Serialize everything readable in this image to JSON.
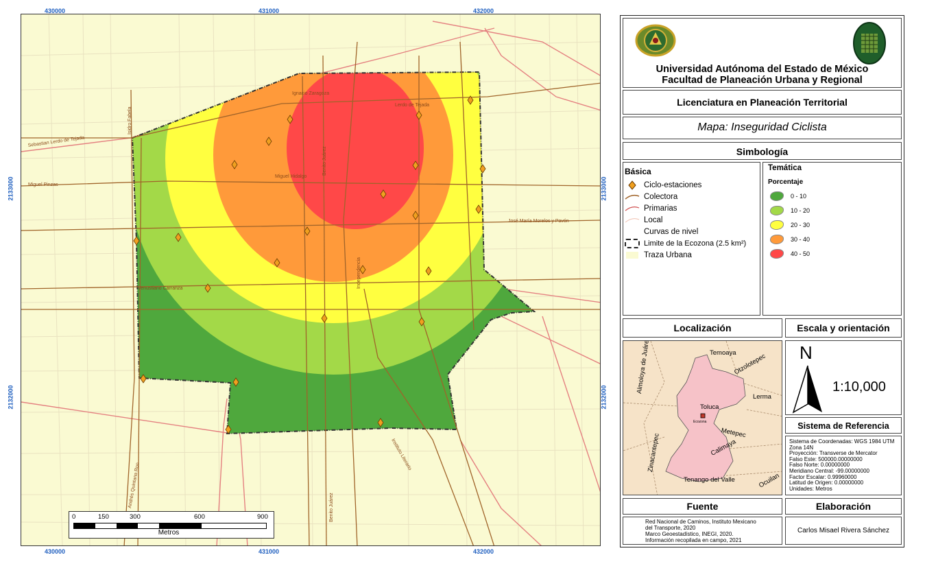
{
  "map": {
    "coords_top": [
      "430000",
      "431000",
      "432000"
    ],
    "coords_bottom": [
      "430000",
      "431000",
      "432000"
    ],
    "coords_left": [
      "2133000",
      "2132000"
    ],
    "coords_right": [
      "2133000",
      "2132000"
    ],
    "streets": {
      "s1": "Sebastian Lerdo de Tejada",
      "s2": "Miguel Pinzas",
      "s3": "Miguel Hidalgo",
      "s4": "José María Morelos y Pavón",
      "s5": "Venustiano Carranza",
      "s6": "Ignacio Zaragoza",
      "s7": "Lerdo de Tejada",
      "s8": "Benito Juárez",
      "s9": "Independencia",
      "s10": "Isidro Fabela",
      "s11": "Andrés Quintana Roo",
      "s12": "Benito Juárez",
      "s13": "Instituto Literario"
    }
  },
  "scale_bar": {
    "ticks": [
      "0",
      "150",
      "300",
      "600",
      "900"
    ],
    "unit": "Metros"
  },
  "header": {
    "university": "Universidad Autónoma del Estado de México",
    "faculty": "Facultad de Planeación Urbana y Regional",
    "degree": "Licenciatura en Planeación Territorial",
    "map_title": "Mapa: Inseguridad Ciclista"
  },
  "legend": {
    "title": "Simbología",
    "basic_title": "Básica",
    "basic_items": [
      "Ciclo-estaciones",
      "Colectora",
      "Primarias",
      "Local",
      "Curvas de nivel",
      "Limite de la Ecozona (2.5 km²)",
      "Traza Urbana"
    ],
    "thematic_title": "Temática",
    "thematic_subtitle": "Porcentaje",
    "thematic_items": [
      {
        "label": "0 - 10",
        "color": "#4fa83d"
      },
      {
        "label": "10 - 20",
        "color": "#a3d948"
      },
      {
        "label": "20 - 30",
        "color": "#ffff40"
      },
      {
        "label": "30 - 40",
        "color": "#ff9a3a"
      },
      {
        "label": "40 - 50",
        "color": "#ff4848"
      }
    ]
  },
  "location": {
    "title": "Localización",
    "labels": {
      "almoloya": "Almoloya de Juárez",
      "temoaya": "Temoaya",
      "otzolotepec": "Otzolotepec",
      "lerma": "Lerma",
      "toluca": "Toluca",
      "ecozona": "Ecozona",
      "zinacantepec": "Zinacantepec",
      "metepec": "Metepec",
      "calimaya": "Calimaya",
      "tenango": "Tenango del Valle",
      "ocuilan": "Ocuilan"
    }
  },
  "scale_orientation": {
    "title": "Escala y orientación",
    "north": "N",
    "scale": "1:10,000"
  },
  "reference": {
    "title": "Sistema de Referencia",
    "lines": [
      "Sistema de Coordenadas: WGS 1984 UTM",
      "Zona 14N",
      "Proyección:  Transverse de Mercator",
      "Falso Este:  500000.00000000",
      "Falso Norte:   0.00000000",
      "Meridiano Central:  -99.00000000",
      "Factor Escalar:  0.99960000",
      "Latitud de Origen:  0.00000000",
      "Unidades:  Metros"
    ]
  },
  "source": {
    "title": "Fuente",
    "lines": [
      "Red Nacional de Caminos, Instituto Mexicano",
      "del                Transporte,                2020",
      "Marco    Geoestadístico,    INEGI,    2020.",
      "Información   recopilada   en   campo,   2021"
    ]
  },
  "credits": {
    "title": "Elaboración",
    "author": "Carlos Misael Rivera Sánchez"
  },
  "colors": {
    "urban": "#fafad2",
    "collector": "#a0642a",
    "primary": "#e07070",
    "coord_text": "#1f5fbf"
  }
}
